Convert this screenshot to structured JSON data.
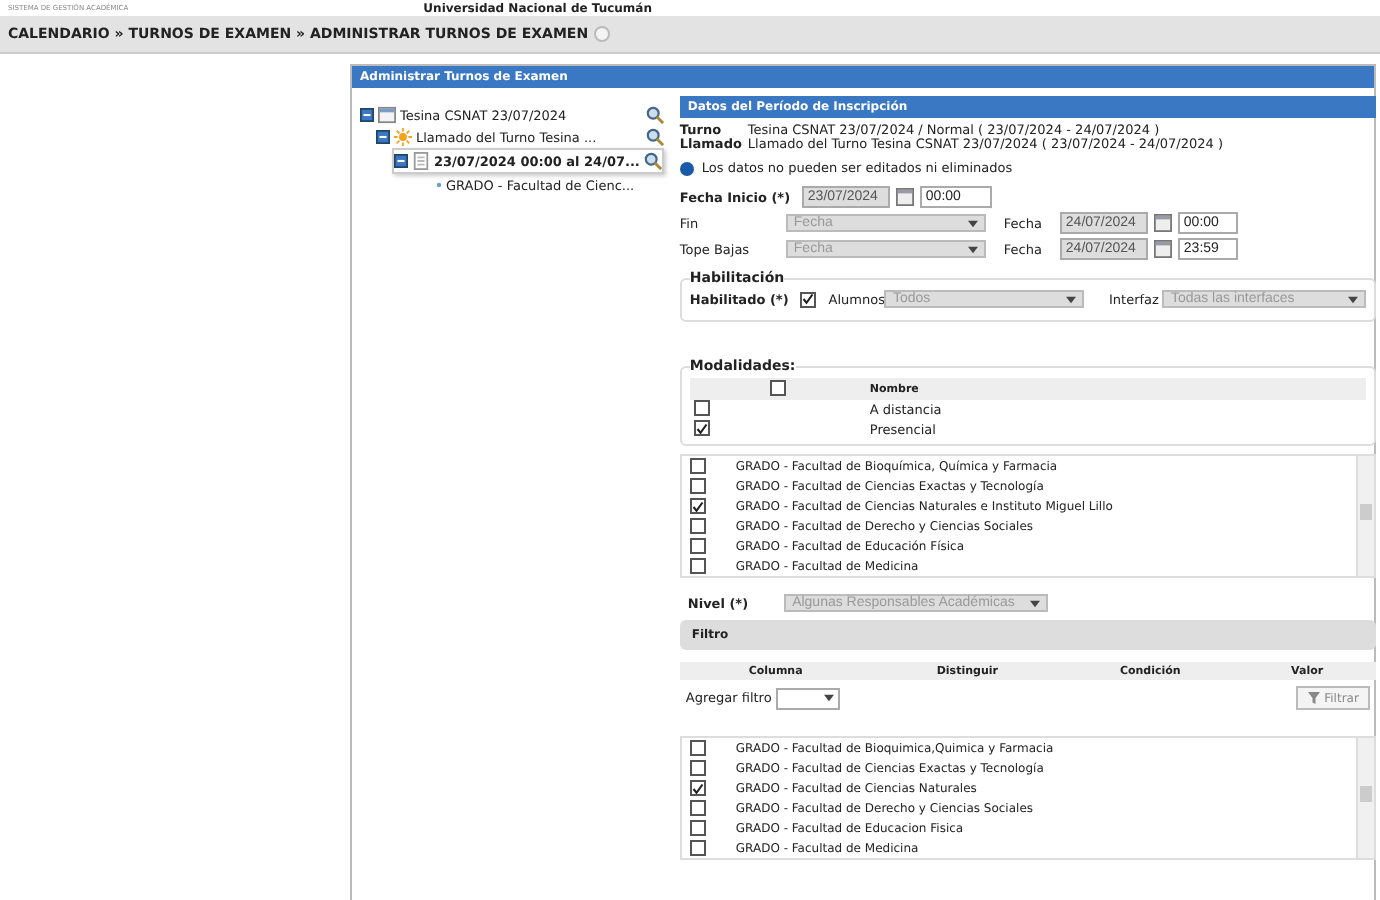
{
  "header": {
    "system_name": "SISTEMA DE GESTIÓN ACADÉMICA",
    "university": "Universidad Nacional de Tucumán"
  },
  "breadcrumb": "CALENDARIO » TURNOS DE EXAMEN » ADMINISTRAR TURNOS DE EXAMEN",
  "panel": {
    "title": "Administrar Turnos de Examen"
  },
  "tree": [
    {
      "kind": "turno",
      "label": "Tesina CSNAT 23/07/2024",
      "expanded": true,
      "selected": false,
      "children": [
        {
          "kind": "llamado",
          "label": "Llamado del Turno Tesina ...",
          "expanded": true,
          "selected": false,
          "children": [
            {
              "kind": "periodo",
              "label": "23/07/2024 00:00 al 24/07...",
              "expanded": true,
              "selected": true,
              "children": [
                {
                  "kind": "leaf",
                  "label": "GRADO - Facultad de Cienc...",
                  "selected": false
                }
              ]
            }
          ]
        }
      ]
    }
  ],
  "form": {
    "title": "Datos del Período de Inscripción",
    "info": [
      {
        "label": "Turno",
        "value": "Tesina CSNAT 23/07/2024 / Normal ( 23/07/2024 - 24/07/2024 )"
      },
      {
        "label": "Llamado",
        "value": "Llamado del Turno Tesina CSNAT 23/07/2024 ( 23/07/2024 - 24/07/2024 )"
      }
    ],
    "notice": "Los datos no pueden ser editados ni eliminados",
    "fecha_inicio": {
      "label": "Fecha Inicio (*)",
      "date": "23/07/2024",
      "time": "00:00"
    },
    "date_rows": [
      {
        "label": "Fin",
        "select": "Fecha",
        "date_label": "Fecha",
        "date": "24/07/2024",
        "time": "00:00"
      },
      {
        "label": "Tope Bajas",
        "select": "Fecha",
        "date_label": "Fecha",
        "date": "24/07/2024",
        "time": "23:59"
      }
    ],
    "habilitacion": {
      "legend": "Habilitación",
      "label": "Habilitado (*)",
      "checked": true,
      "alumnos_label": "Alumnos",
      "alumnos": "Todos",
      "interfaz_label": "Interfaz",
      "interfaz": "Todas las interfaces"
    },
    "modalidades": {
      "legend": "Modalidades:",
      "all_checked": false,
      "column": "Nombre",
      "rows": [
        {
          "name": "A distancia",
          "checked": false
        },
        {
          "name": "Presencial",
          "checked": true
        }
      ]
    },
    "facultades_1": [
      {
        "name": "GRADO - Facultad de Bioquímica, Química y Farmacia",
        "checked": false
      },
      {
        "name": "GRADO - Facultad de Ciencias Exactas y Tecnología",
        "checked": false
      },
      {
        "name": "GRADO - Facultad de Ciencias Naturales e Instituto Miguel Lillo",
        "checked": true
      },
      {
        "name": "GRADO - Facultad de Derecho y Ciencias Sociales",
        "checked": false
      },
      {
        "name": "GRADO - Facultad de Educación Física",
        "checked": false
      },
      {
        "name": "GRADO - Facultad de Medicina",
        "checked": false
      }
    ],
    "nivel": {
      "label": "Nivel (*)",
      "value": "Algunas Responsables Académicas"
    },
    "filtro": {
      "title": "Filtro",
      "columns": [
        "Columna",
        "Distinguir",
        "Condición",
        "Valor"
      ],
      "add_label": "Agregar filtro",
      "button": "Filtrar"
    },
    "facultades_2": [
      {
        "name": "GRADO - Facultad de Bioquimica,Quimica y Farmacia",
        "checked": false
      },
      {
        "name": "GRADO - Facultad de Ciencias Exactas y Tecnología",
        "checked": false
      },
      {
        "name": "GRADO - Facultad de Ciencias Naturales",
        "checked": true
      },
      {
        "name": "GRADO - Facultad de Derecho y Ciencias Sociales",
        "checked": false
      },
      {
        "name": "GRADO - Facultad de Educacion Fisica",
        "checked": false
      },
      {
        "name": "GRADO - Facultad de Medicina",
        "checked": false
      }
    ]
  }
}
